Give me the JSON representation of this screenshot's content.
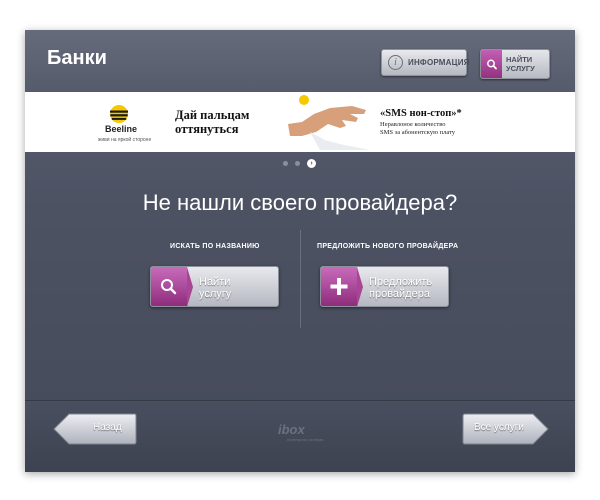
{
  "header": {
    "title": "Банки",
    "info_label": "ИНФОРМАЦИЯ",
    "find_line1": "НАЙТИ",
    "find_line2": "УСЛУГУ"
  },
  "banner": {
    "brand": "Beeline",
    "slogan": "живи на яркой стороне",
    "headline_1": "Дай пальцам",
    "headline_2": "оттянуться",
    "offer_title": "«SMS нон-стоп»*",
    "offer_line1": "Неравлоное количество",
    "offer_line2": "SMS за абонентскую плату"
  },
  "carousel": {
    "dot_count": 3,
    "active_index": 2
  },
  "main": {
    "question": "Не нашли своего провайдера?",
    "left_label": "ИСКАТЬ ПО НАЗВАНИЮ",
    "right_label": "ПРЕДЛОЖИТЬ НОВОГО ПРОВАЙДЕРА",
    "find_btn_1": "Найти",
    "find_btn_2": "услугу",
    "propose_btn_1": "Предложить",
    "propose_btn_2": "провайдера"
  },
  "footer": {
    "back_label": "Назад",
    "all_label": "Все услуги",
    "logo": "ibox",
    "logo_sub": "платежная система"
  },
  "colors": {
    "accent": "#a84595",
    "background": "#4d5263",
    "button_light": "#e8e9ed"
  },
  "icons": [
    "info-icon",
    "search-icon",
    "plus-icon",
    "arrow-left",
    "arrow-right"
  ]
}
